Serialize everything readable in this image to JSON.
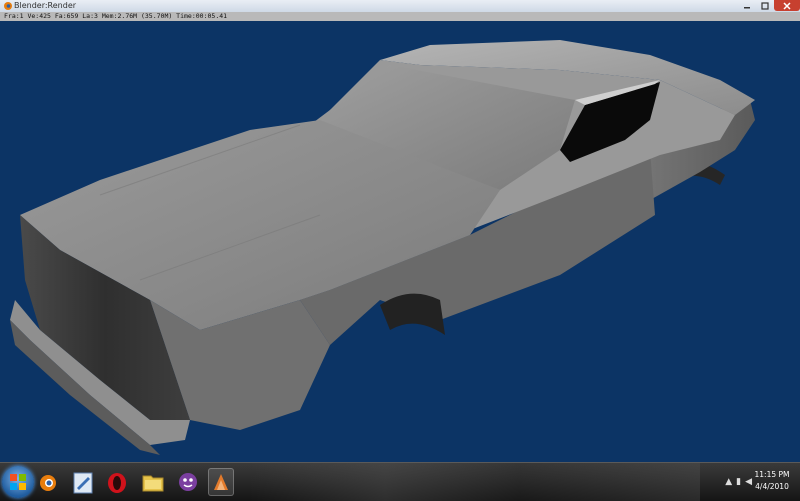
{
  "window": {
    "title": "Blender:Render"
  },
  "render_info": {
    "text": "Fra:1   Ve:425  Fa:659  La:3  Mem:2.76M (35.70M)  Time:00:05.41"
  },
  "colors": {
    "viewport_bg": "#0c3465",
    "model": "#8a8a8a"
  },
  "taskbar": {
    "apps": [
      "start-orb",
      "blender-icon",
      "paint-icon",
      "opera-icon",
      "explorer-icon",
      "messenger-icon",
      "blender-render-icon"
    ],
    "clock_time": "11:15 PM",
    "clock_date": "4/4/2010"
  }
}
